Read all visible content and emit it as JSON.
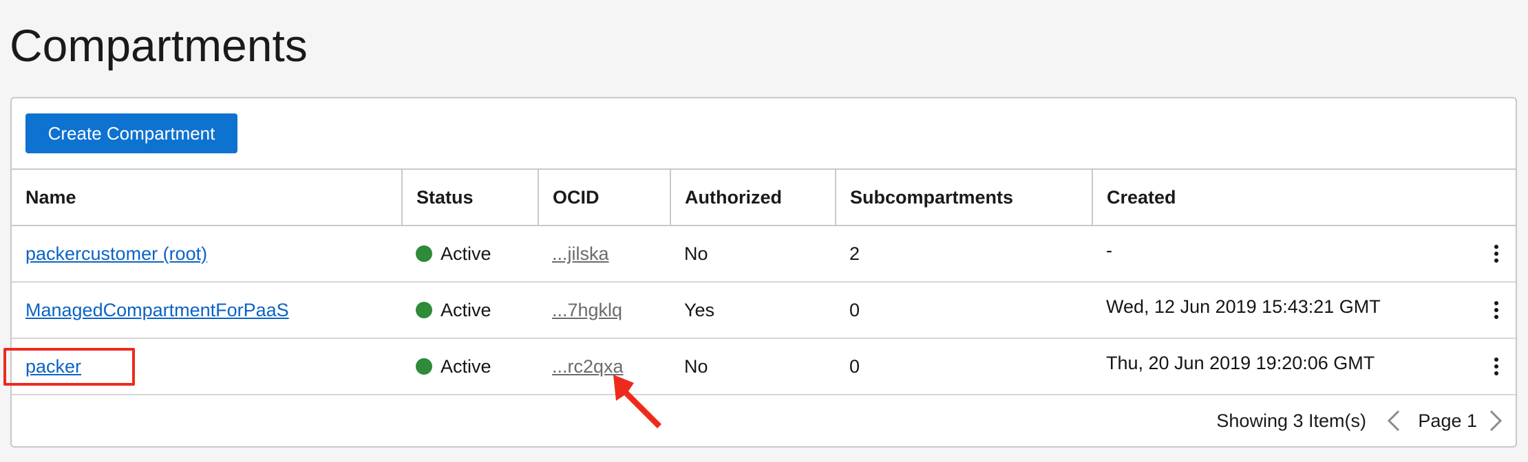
{
  "page": {
    "title": "Compartments"
  },
  "toolbar": {
    "create_label": "Create Compartment"
  },
  "table": {
    "columns": [
      "Name",
      "Status",
      "OCID",
      "Authorized",
      "Subcompartments",
      "Created"
    ],
    "rows": [
      {
        "name": "packercustomer (root)",
        "status": "Active",
        "ocid": "...jilska",
        "authorized": "No",
        "subcompartments": "2",
        "created": "-"
      },
      {
        "name": "ManagedCompartmentForPaaS",
        "status": "Active",
        "ocid": "...7hgklq",
        "authorized": "Yes",
        "subcompartments": "0",
        "created": "Wed, 12 Jun 2019 15:43:21 GMT"
      },
      {
        "name": "packer",
        "status": "Active",
        "ocid": "...rc2qxa",
        "authorized": "No",
        "subcompartments": "0",
        "created": "Thu, 20 Jun 2019 19:20:06 GMT"
      }
    ]
  },
  "footer": {
    "showing": "Showing 3 Item(s)",
    "page": "Page 1"
  },
  "icons": {
    "status_active": "status-dot-icon",
    "row_actions": "kebab-menu-icon",
    "prev_page": "chevron-left-icon",
    "next_page": "chevron-right-icon",
    "annotation": "arrow-icon"
  },
  "colors": {
    "primary_button": "#0e72d0",
    "link": "#0b63c5",
    "status_active": "#2f8a3a",
    "annotation": "#ee2a1c"
  }
}
